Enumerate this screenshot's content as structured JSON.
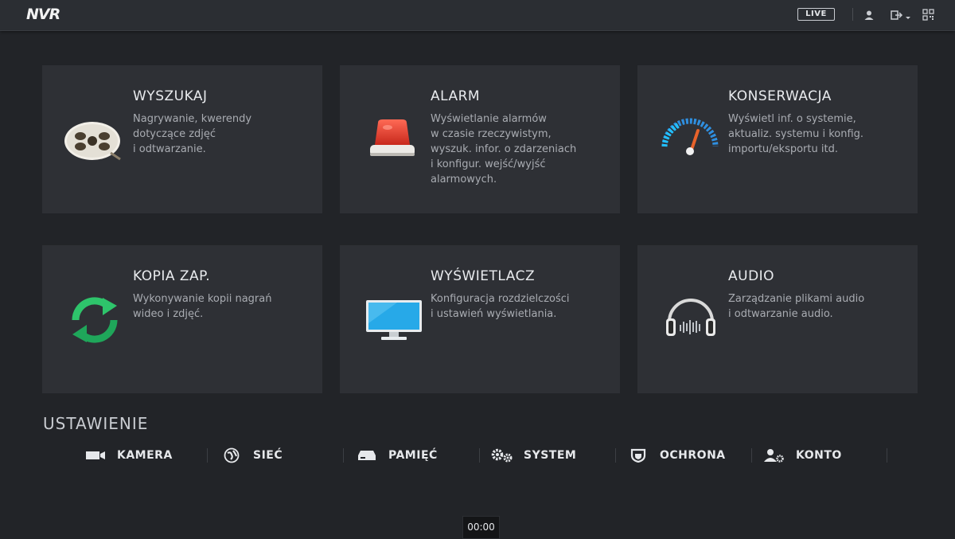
{
  "topbar": {
    "logo_text": "NVR",
    "live_label": "LIVE",
    "icons": [
      "user-icon",
      "logout-icon",
      "qr-code-icon"
    ]
  },
  "tiles": [
    {
      "title": "WYSZUKAJ",
      "icon": "film-reel-icon",
      "desc": [
        "Nagrywanie, kwerendy",
        "dotyczące zdjęć",
        "i odtwarzanie."
      ]
    },
    {
      "title": "ALARM",
      "icon": "alarm-siren-icon",
      "desc": [
        "Wyświetlanie alarmów",
        "w czasie rzeczywistym,",
        "wyszuk. infor. o zdarzeniach",
        "i konfigur. wejść/wyjść",
        "alarmowych."
      ]
    },
    {
      "title": "KONSERWACJA",
      "icon": "gauge-icon",
      "desc": [
        "Wyświetl inf. o systemie,",
        "aktualiz. systemu i konfig.",
        "importu/eksportu itd."
      ]
    },
    {
      "title": "KOPIA ZAP.",
      "icon": "sync-arrows-icon",
      "desc": [
        "Wykonywanie kopii nagrań",
        "wideo i zdjęć."
      ]
    },
    {
      "title": "WYŚWIETLACZ",
      "icon": "monitor-icon",
      "desc": [
        "Konfiguracja rozdzielczości",
        "i ustawień wyświetlania."
      ]
    },
    {
      "title": "AUDIO",
      "icon": "headphones-icon",
      "desc": [
        "Zarządzanie plikami audio",
        "i odtwarzanie audio."
      ]
    }
  ],
  "settings": {
    "title": "USTAWIENIE",
    "items": [
      {
        "label": "KAMERA",
        "icon": "camera-icon"
      },
      {
        "label": "SIEĆ",
        "icon": "globe-icon"
      },
      {
        "label": "PAMIĘĆ",
        "icon": "storage-icon"
      },
      {
        "label": "SYSTEM",
        "icon": "gears-icon"
      },
      {
        "label": "OCHRONA",
        "icon": "shield-icon"
      },
      {
        "label": "KONTO",
        "icon": "user-settings-icon"
      }
    ]
  },
  "clock": "00:00",
  "colors": {
    "background": "#222428",
    "tile": "#2e3035",
    "topbar": "#2b2e33",
    "alarm_red": "#e0392b",
    "sync_green": "#2ec46b",
    "gauge_blue": "#2f8fe0"
  }
}
